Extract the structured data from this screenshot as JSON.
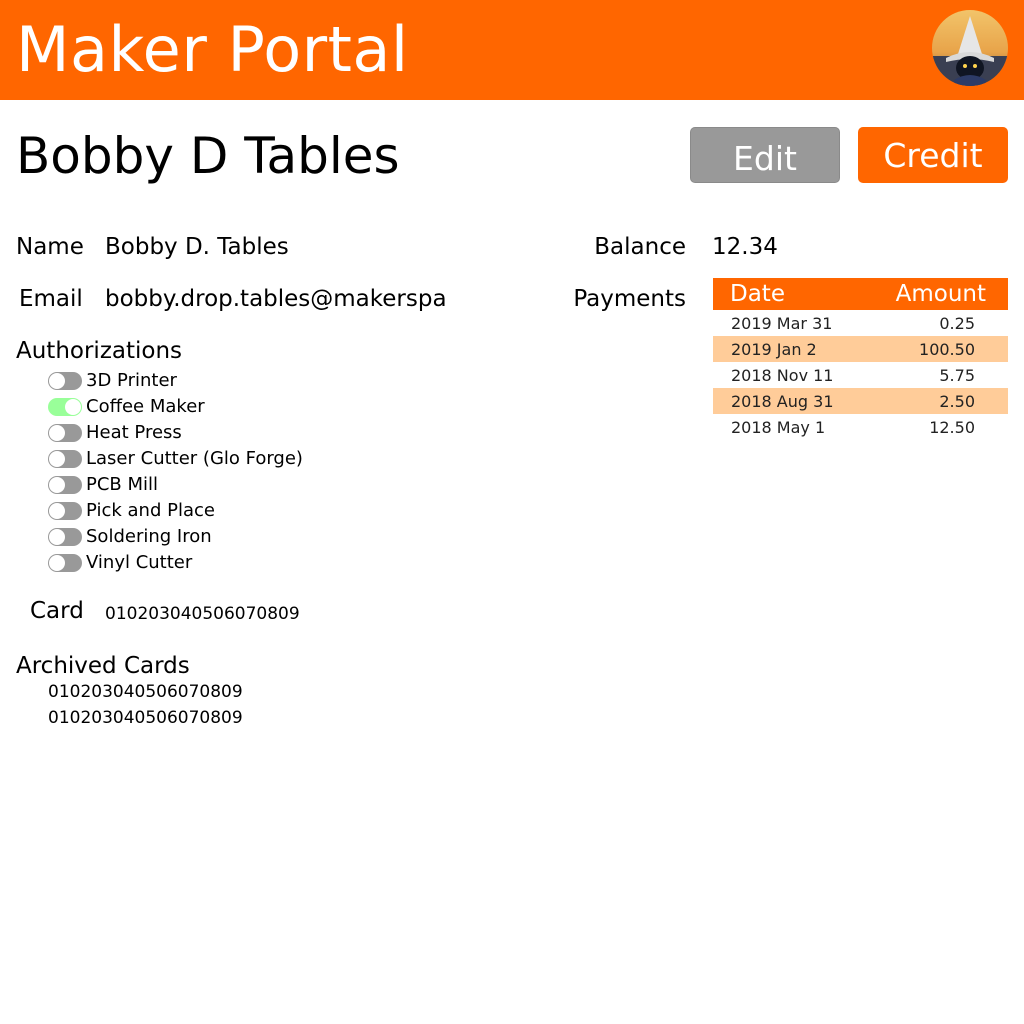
{
  "header": {
    "app_title": "Maker Portal",
    "avatar_icon": "user-avatar-icon",
    "background_color": "#ff6600"
  },
  "page": {
    "title": "Bobby D Tables",
    "edit_label": "Edit",
    "credit_label": "Credit"
  },
  "profile": {
    "name_label": "Name",
    "name_value": "Bobby D. Tables",
    "email_label": "Email",
    "email_value": "bobby.drop.tables@makerspa",
    "balance_label": "Balance",
    "balance_value": "12.34",
    "payments_label": "Payments"
  },
  "authorizations": {
    "heading": "Authorizations",
    "items": [
      {
        "label": "3D Printer",
        "enabled": false
      },
      {
        "label": "Coffee Maker",
        "enabled": true
      },
      {
        "label": "Heat Press",
        "enabled": false
      },
      {
        "label": "Laser Cutter (Glo Forge)",
        "enabled": false
      },
      {
        "label": "PCB Mill",
        "enabled": false
      },
      {
        "label": "Pick and Place",
        "enabled": false
      },
      {
        "label": "Soldering Iron",
        "enabled": false
      },
      {
        "label": "Vinyl Cutter",
        "enabled": false
      }
    ]
  },
  "card": {
    "label": "Card",
    "number": "010203040506070809"
  },
  "archived_cards": {
    "heading": "Archived Cards",
    "items": [
      "010203040506070809",
      "010203040506070809"
    ]
  },
  "payments": {
    "columns": [
      "Date",
      "Amount"
    ],
    "rows": [
      {
        "date": "2019 Mar 31",
        "amount": "0.25"
      },
      {
        "date": "2019 Jan 2",
        "amount": "100.50"
      },
      {
        "date": "2018 Nov 11",
        "amount": "5.75"
      },
      {
        "date": "2018 Aug 31",
        "amount": "2.50"
      },
      {
        "date": "2018 May 1",
        "amount": "12.50"
      }
    ]
  },
  "colors": {
    "accent": "#ff6600",
    "row_highlight": "#ffcc99",
    "toggle_off": "#999999",
    "toggle_on": "#99ff99",
    "edit_button": "#999999"
  }
}
